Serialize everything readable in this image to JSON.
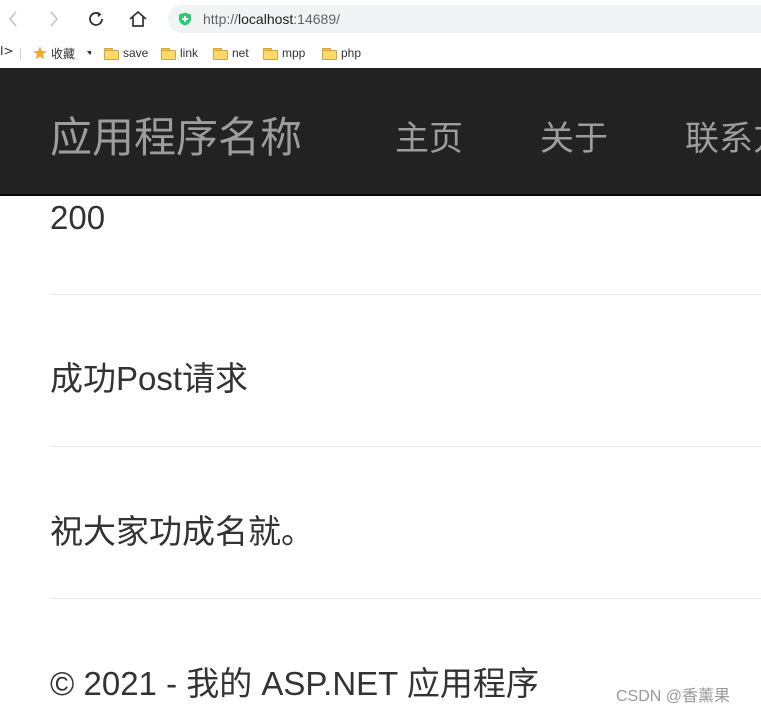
{
  "browser": {
    "url_prefix": "http://",
    "url_host": "localhost",
    "url_suffix": ":14689/"
  },
  "bookmarks": {
    "sidebar_glyph": "I>",
    "favorites_label": "收藏",
    "items": [
      {
        "label": "save"
      },
      {
        "label": "link"
      },
      {
        "label": "net"
      },
      {
        "label": "mpp"
      },
      {
        "label": "php"
      }
    ]
  },
  "navbar": {
    "brand": "应用程序名称",
    "links": [
      {
        "label": "主页"
      },
      {
        "label": "关于"
      },
      {
        "label": "联系方"
      }
    ]
  },
  "main": {
    "status_code": "200",
    "message": "成功Post请求",
    "greeting": "祝大家功成名就。"
  },
  "footer": {
    "copyright": "© 2021 - 我的 ASP.NET 应用程序"
  },
  "watermark": "CSDN @香薰果",
  "colors": {
    "navbar_bg": "#222222",
    "navbar_text": "#9d9d9d",
    "shield": "#2ecc71",
    "folder": "#ffd96b",
    "star": "#f5a623"
  },
  "icons": [
    "back-icon",
    "forward-icon",
    "reload-icon",
    "home-icon",
    "shield-icon",
    "star-icon",
    "chevron-down-icon",
    "folder-icon"
  ]
}
